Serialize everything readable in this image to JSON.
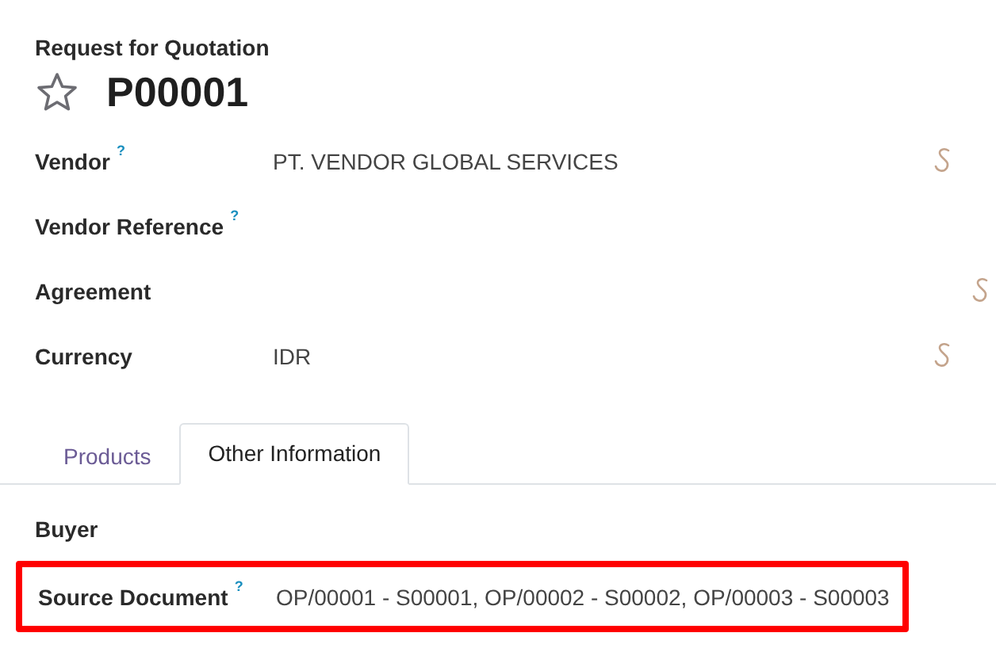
{
  "header": {
    "subtitle": "Request for Quotation",
    "title": "P00001",
    "starred": false
  },
  "fields": [
    {
      "label": "Vendor",
      "help": "?",
      "value": "PT. VENDOR GLOBAL SERVICES",
      "kind": "widget"
    },
    {
      "label": "Vendor Reference",
      "help": "?",
      "kind": "plain"
    },
    {
      "label": "Agreement",
      "kind": "shifted"
    },
    {
      "label": "Currency",
      "value": "IDR",
      "kind": "widget"
    }
  ],
  "tabs": [
    {
      "label": "Products",
      "selected": false
    },
    {
      "label": "Other Information",
      "selected": true
    }
  ],
  "tab_fields": [
    {
      "label": "Buyer",
      "highlighted": false
    },
    {
      "label": "Source Document",
      "help": "?",
      "value": "OP/00001 - S00001, OP/00002 - S00002, OP/00003 - S00003",
      "highlighted": true
    }
  ]
}
